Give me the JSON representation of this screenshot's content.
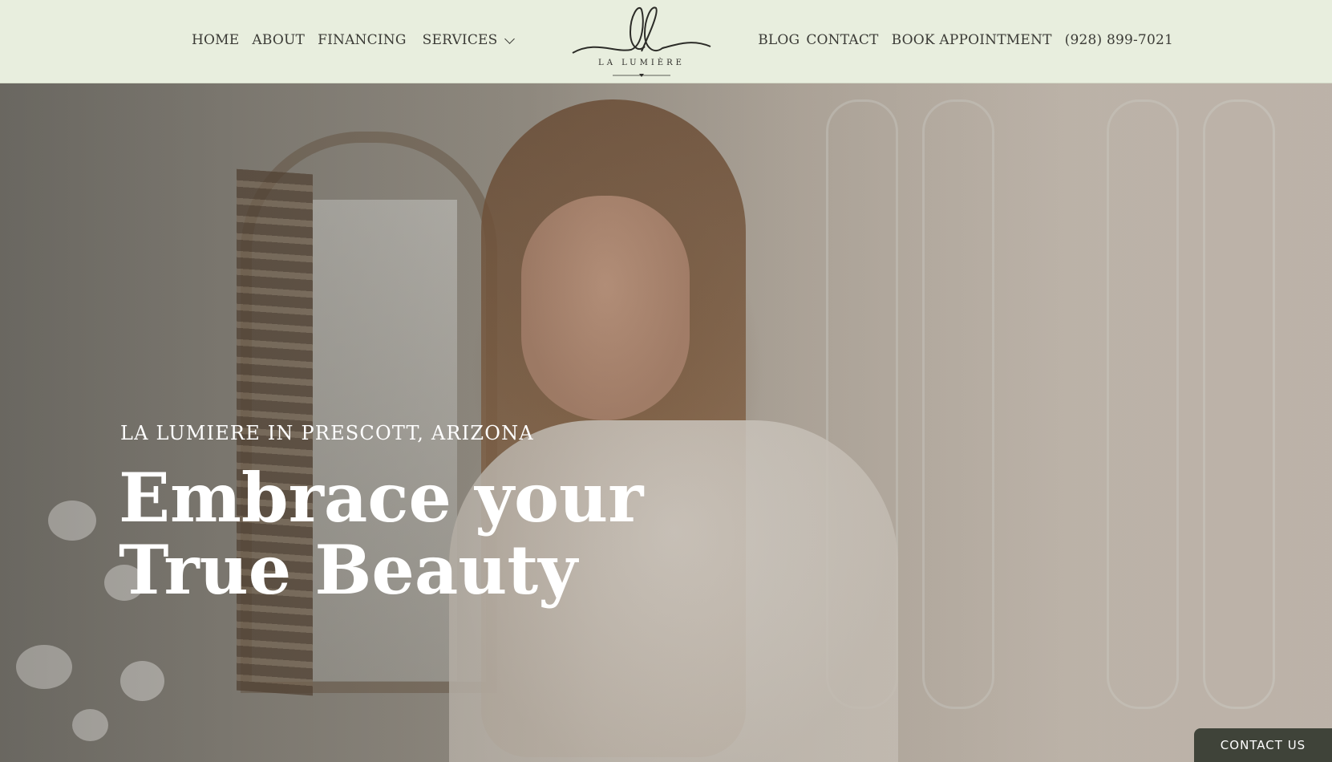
{
  "nav": {
    "left": [
      "HOME",
      "ABOUT",
      "FINANCING",
      "SERVICES"
    ],
    "right": {
      "blog": "BLOG",
      "contact": "CONTACT",
      "book": "BOOK APPOINTMENT",
      "phone": "(928) 899-7021"
    }
  },
  "logo": {
    "text": "LA LUMIÈRE",
    "icon": "ll-monogram-logo"
  },
  "hero": {
    "tagline": "LA LUMIERE IN PRESCOTT, ARIZONA",
    "headline_line1": "Embrace your",
    "headline_line2": "True Beauty"
  },
  "contact_button": "CONTACT US",
  "colors": {
    "header_bg": "#e8eede",
    "nav_text": "#3b3b36",
    "hero_text": "#ffffff",
    "contact_button_bg": "#3f4339"
  }
}
